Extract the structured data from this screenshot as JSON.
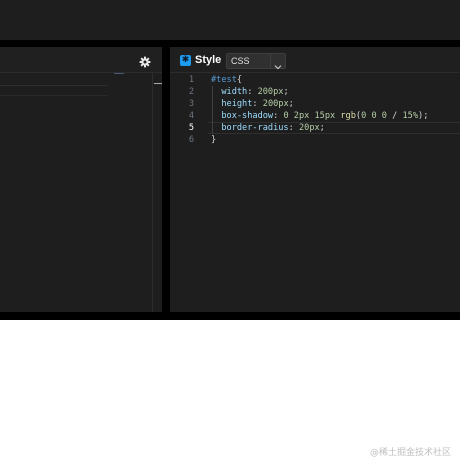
{
  "left_panel": {
    "settings_icon": "gear-icon"
  },
  "right_panel": {
    "icon": "style-icon",
    "title": "Style",
    "language": {
      "selected": "CSS",
      "icon": "chevron-down-icon"
    }
  },
  "editor": {
    "active_line": 5,
    "lines": [
      {
        "number": "1",
        "tokens": [
          {
            "t": "#test",
            "c": "selector"
          },
          {
            "t": "{",
            "c": "punct"
          }
        ]
      },
      {
        "number": "2",
        "indent": true,
        "tokens": [
          {
            "t": "  width",
            "c": "prop"
          },
          {
            "t": ": ",
            "c": "punct"
          },
          {
            "t": "200px",
            "c": "num"
          },
          {
            "t": ";",
            "c": "punct"
          }
        ]
      },
      {
        "number": "3",
        "indent": true,
        "tokens": [
          {
            "t": "  height",
            "c": "prop"
          },
          {
            "t": ": ",
            "c": "punct"
          },
          {
            "t": "200px",
            "c": "num"
          },
          {
            "t": ";",
            "c": "punct"
          }
        ]
      },
      {
        "number": "4",
        "indent": true,
        "tokens": [
          {
            "t": "  box-shadow",
            "c": "prop"
          },
          {
            "t": ": ",
            "c": "punct"
          },
          {
            "t": "0 2px 15px ",
            "c": "num"
          },
          {
            "t": "rgb",
            "c": "fn"
          },
          {
            "t": "(",
            "c": "punct"
          },
          {
            "t": "0 0 0",
            "c": "num"
          },
          {
            "t": " / ",
            "c": "punct"
          },
          {
            "t": "15%",
            "c": "num"
          },
          {
            "t": ");",
            "c": "punct"
          }
        ]
      },
      {
        "number": "5",
        "indent": true,
        "tokens": [
          {
            "t": "  border-radius",
            "c": "prop"
          },
          {
            "t": ": ",
            "c": "punct"
          },
          {
            "t": "20px",
            "c": "num"
          },
          {
            "t": ";",
            "c": "punct"
          }
        ]
      },
      {
        "number": "6",
        "tokens": [
          {
            "t": "}",
            "c": "punct"
          }
        ]
      }
    ]
  },
  "watermark": "@稀土掘金技术社区",
  "colors": {
    "background": "#000000",
    "panel": "#1e1e1e",
    "accent": "#1d9bf0",
    "selector": "#569cd6",
    "property": "#9cdcfe",
    "number": "#b5cea8",
    "function": "#dcdcaa"
  }
}
